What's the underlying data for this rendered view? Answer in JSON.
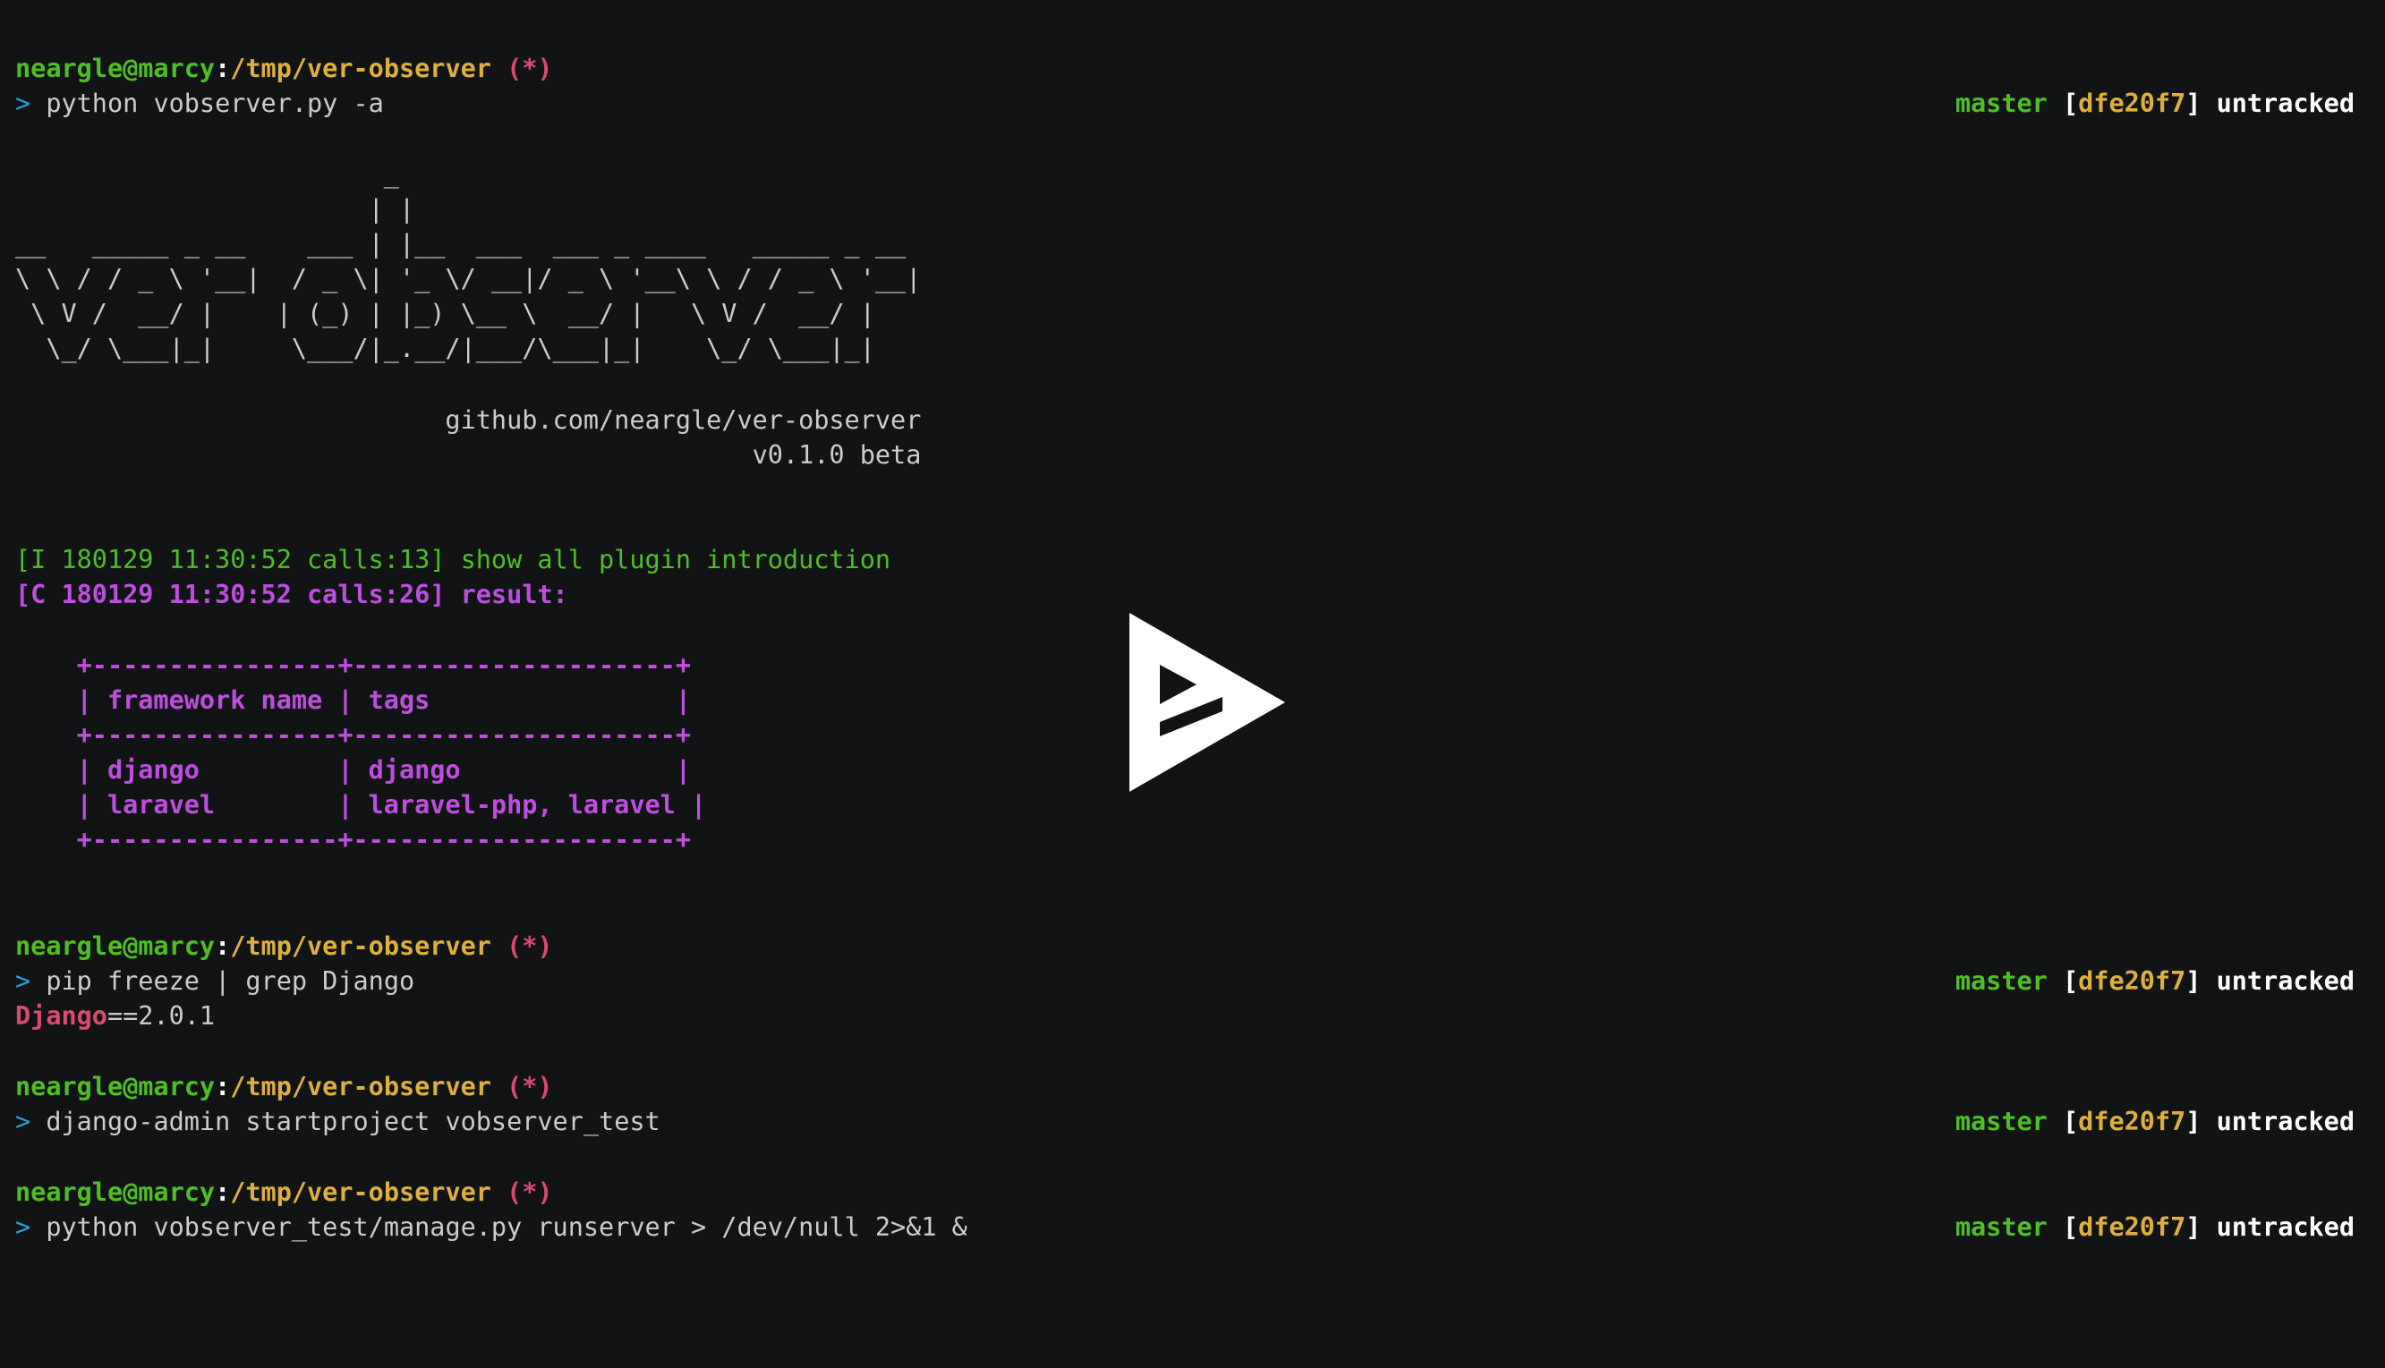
{
  "prompt": {
    "user_host": "neargle@marcy",
    "sep": ":",
    "path": "/tmp/ver-observer",
    "status": " (*)",
    "arrow": ">"
  },
  "git": {
    "branch": "master",
    "open_bracket": " [",
    "hash": "dfe20f7",
    "close_bracket": "]",
    "state": " untracked"
  },
  "commands": {
    "c1": " python vobserver.py -a",
    "c2": " pip freeze | grep Django",
    "c3": " django-admin startproject vobserver_test",
    "c4": " python vobserver_test/manage.py runserver > /dev/null 2>&1 &"
  },
  "banner": {
    "l1": "                        _",
    "l2": "                       | |",
    "l3": "__   _____ _ __    ___ | |__  ___  ___ _ ____   _____ _ __",
    "l4": "\\ \\ / / _ \\ '__|  / _ \\| '_ \\/ __|/ _ \\ '__\\ \\ / / _ \\ '__|",
    "l5": " \\ V /  __/ |    | (_) | |_) \\__ \\  __/ |   \\ V /  __/ |",
    "l6": "  \\_/ \\___|_|     \\___/|_.__/|___/\\___|_|    \\_/ \\___|_|",
    "url": "                            github.com/neargle/ver-observer",
    "version": "                                                v0.1.0 beta"
  },
  "log": {
    "info": "[I 180129 11:30:52 calls:13] show all plugin introduction",
    "critical": "[C 180129 11:30:52 calls:26] result:"
  },
  "table": {
    "border": "    +----------------+---------------------+",
    "header": "    | framework name | tags                |",
    "row1": "    | django         | django              |",
    "row2": "    | laravel        | laravel-php, laravel |"
  },
  "freeze_output": {
    "pkg": "Django",
    "version": "==2.0.1"
  },
  "colors": {
    "background": "#121314",
    "green": "#4ebf22",
    "yellow": "#ddaf3c",
    "red": "#d84a6e",
    "cyan": "#26a0d4",
    "magenta": "#bd4ee0",
    "text": "#cccccc"
  },
  "icons": {
    "play": "asciinema-play-icon"
  }
}
